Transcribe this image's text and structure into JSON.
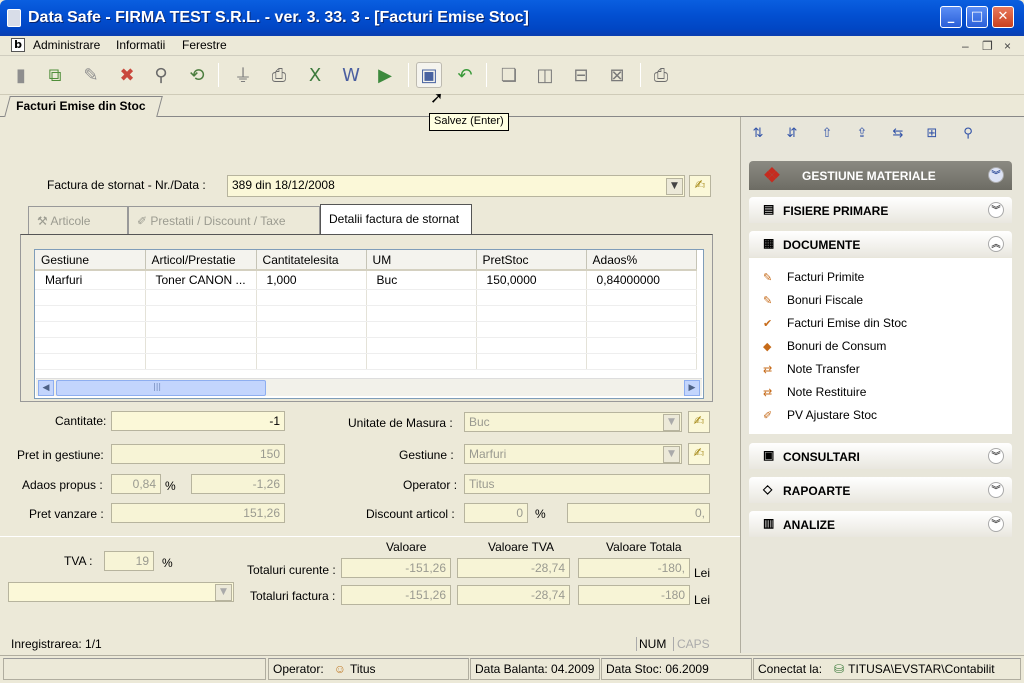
{
  "window": {
    "title": "Data Safe - FIRMA TEST S.R.L. - ver. 3. 33. 3 - [Facturi Emise Stoc]",
    "minimize": "_",
    "maximize": "□",
    "close": "✕"
  },
  "menu": {
    "items": [
      "Administrare",
      "Informatii",
      "Ferestre"
    ],
    "app_icon": "b",
    "mdi": {
      "min": "–",
      "restore": "❐",
      "close": "×"
    }
  },
  "toolbar": {
    "buttons": [
      {
        "name": "new-icon",
        "glyph": "▮",
        "color": "#8e8e8e"
      },
      {
        "name": "copy-icon",
        "glyph": "⧉",
        "color": "#4f8e3a"
      },
      {
        "name": "edit-icon",
        "glyph": "✎",
        "color": "#8e8e8e"
      },
      {
        "name": "delete-icon",
        "glyph": "✖",
        "color": "#c9473c"
      },
      {
        "name": "search-icon",
        "glyph": "⚲",
        "color": "#6a6a6a"
      },
      {
        "name": "refresh-icon",
        "glyph": "⟲",
        "color": "#4b7d3e"
      },
      {
        "name": "filter-icon",
        "glyph": "⏚",
        "color": "#7d7d7d"
      },
      {
        "name": "print-icon",
        "glyph": "⎙",
        "color": "#6c6c6c"
      },
      {
        "name": "excel-icon",
        "glyph": "X",
        "color": "#3c7a3c"
      },
      {
        "name": "word-icon",
        "glyph": "W",
        "color": "#4b5fa0"
      },
      {
        "name": "go-icon",
        "glyph": "▶",
        "color": "#3d8a3d"
      },
      {
        "name": "save-icon",
        "glyph": "▣",
        "color": "#4862a0"
      },
      {
        "name": "undo-icon",
        "glyph": "↶",
        "color": "#3a9a3a"
      },
      {
        "name": "cascade-icon",
        "glyph": "❏",
        "color": "#7a7a7a"
      },
      {
        "name": "tile-vertical-icon",
        "glyph": "◫",
        "color": "#7a7a7a"
      },
      {
        "name": "tile-horizontal-icon",
        "glyph": "⊟",
        "color": "#7a7a7a"
      },
      {
        "name": "close-windows-icon",
        "glyph": "⊠",
        "color": "#7a7a7a"
      },
      {
        "name": "printer-icon",
        "glyph": "⎙",
        "color": "#6c6c6c"
      }
    ],
    "tooltip": "Salvez (Enter)"
  },
  "tab_main": "Facturi Emise din Stoc",
  "invoice": {
    "label": "Factura de stornat - Nr./Data :",
    "value": "389  din  18/12/2008"
  },
  "inner_tabs": [
    "Articole",
    "Prestatii / Discount / Taxe",
    "Detalii factura de stornat"
  ],
  "grid": {
    "columns": [
      "Gestiune",
      "Articol/Prestatie",
      "Cantitatelesita",
      "UM",
      "PretStoc",
      "Adaos%"
    ],
    "rows": [
      [
        "Marfuri",
        "Toner CANON    ...",
        "1,000",
        "Buc",
        "150,0000",
        "0,84000000"
      ]
    ],
    "thumb_glyph": "|||"
  },
  "form": {
    "cantitate": {
      "label": "Cantitate:",
      "value": "-1"
    },
    "pret_gestiune": {
      "label": "Pret in gestiune:",
      "value": "150"
    },
    "adaos": {
      "label": "Adaos propus :",
      "value": "0,84",
      "pct": "%",
      "value2": "-1,26"
    },
    "pret_vanzare": {
      "label": "Pret vanzare :",
      "value": "151,26"
    },
    "um": {
      "label": "Unitate de Masura :",
      "value": "Buc"
    },
    "gestiune": {
      "label": "Gestiune :",
      "value": "Marfuri"
    },
    "operator": {
      "label": "Operator :",
      "value": "Titus"
    },
    "discount": {
      "label": "Discount articol :",
      "value": "0",
      "pct": "%",
      "value2": "0,"
    }
  },
  "totals": {
    "tva_label": "TVA :",
    "tva_value": "19",
    "tva_pct": "%",
    "headers": [
      "Valoare",
      "Valoare TVA",
      "Valoare Totala"
    ],
    "curente": {
      "label": "Totaluri curente :",
      "values": [
        "-151,26",
        "-28,74",
        "-180,"
      ],
      "unit": "Lei"
    },
    "factura": {
      "label": "Totaluri factura :",
      "values": [
        "-151,26",
        "-28,74",
        "-180"
      ],
      "unit": "Lei"
    }
  },
  "record": "Inregistrarea: 1/1",
  "keys": {
    "num": "NUM",
    "caps": "CAPS"
  },
  "right_toolbar": [
    "⇅",
    "⇵",
    "⇧",
    "⇪",
    "⇆",
    "⊞",
    "⚲"
  ],
  "taskpane": {
    "header": "GESTIUNE MATERIALE",
    "groups": [
      {
        "label": "FISIERE PRIMARE",
        "icon": "▤",
        "expanded": false
      },
      {
        "label": "DOCUMENTE",
        "icon": "▦",
        "expanded": true
      },
      {
        "label": "CONSULTARI",
        "icon": "▣",
        "expanded": false
      },
      {
        "label": "RAPOARTE",
        "icon": "◇",
        "expanded": false
      },
      {
        "label": "ANALIZE",
        "icon": "▥",
        "expanded": false
      }
    ],
    "documente": [
      "Facturi Primite",
      "Bonuri Fiscale",
      "Facturi Emise din Stoc",
      "Bonuri de Consum",
      "Note Transfer",
      "Note Restituire",
      "PV Ajustare Stoc"
    ]
  },
  "status": {
    "operator_label": "Operator:",
    "operator": "Titus",
    "balanta": "Data Balanta: 04.2009",
    "stoc": "Data Stoc: 06.2009",
    "conectat_label": "Conectat la:",
    "conectat": "TITUSA\\EVSTAR\\Contabilit"
  }
}
